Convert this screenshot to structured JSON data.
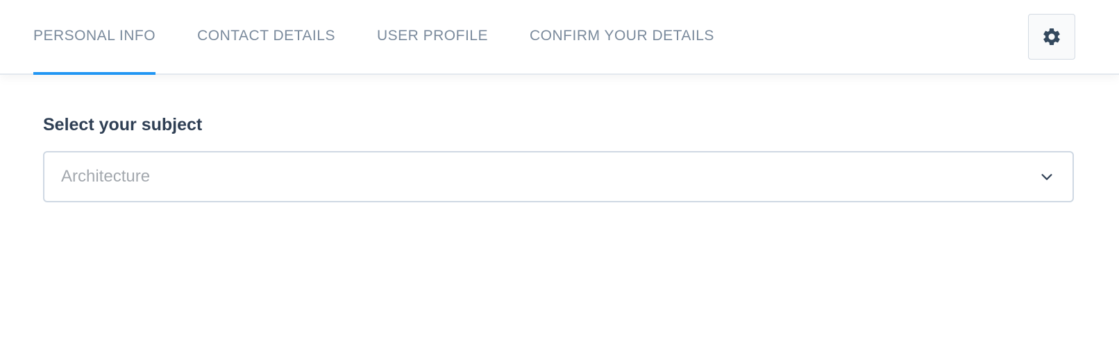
{
  "tabs": [
    {
      "label": "PERSONAL INFO",
      "active": true
    },
    {
      "label": "CONTACT DETAILS",
      "active": false
    },
    {
      "label": "USER PROFILE",
      "active": false
    },
    {
      "label": "CONFIRM YOUR DETAILS",
      "active": false
    }
  ],
  "settings": {
    "icon": "gear-icon"
  },
  "form": {
    "subject_label": "Select your subject",
    "subject_select": {
      "value": "Architecture",
      "icon": "chevron-down-icon"
    }
  },
  "colors": {
    "accent": "#2196f3",
    "tab_text": "#7a8a9c",
    "label_text": "#2f3f54",
    "placeholder_text": "#a3a8ae",
    "border": "#cfd8e3"
  }
}
